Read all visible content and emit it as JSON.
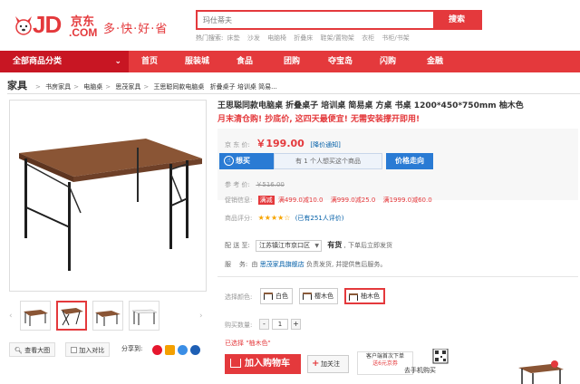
{
  "header": {
    "logo_jd": "JD",
    "logo_cn": "京东",
    "logo_com": ".COM",
    "slogan": "多·快·好·省",
    "search_placeholder": "玛仕蒂夫",
    "search_button": "搜索",
    "hot_label": "热门搜索:",
    "hot_words": [
      "床垫",
      "沙发",
      "电脑椅",
      "折叠床",
      "鞋架/置物架",
      "衣柜",
      "书柜/书架"
    ]
  },
  "nav": {
    "all_categories": "全部商品分类",
    "items": [
      "首页",
      "服装城",
      "食品",
      "团购",
      "夺宝岛",
      "闪购",
      "金融"
    ]
  },
  "breadcrumb": {
    "home": "家具",
    "items": [
      "书房家具",
      "电脑桌",
      "思茂家具",
      "王思聪同款电脑桌",
      "折叠桌子 培训桌 简易..."
    ]
  },
  "product": {
    "title": "王思聪同款电脑桌 折叠桌子 培训桌 简易桌 方桌 书桌 1200*450*750mm 柚木色",
    "promo": "月末清仓购! 抄底价, 这四天最便宜! 无需安装撑开即用!",
    "jd_price_label": "京 东 价:",
    "jd_price": "￥199.00",
    "price_notice": "[降价通知]",
    "want_button": "想买",
    "want_count": "有 1 个人想买这个商品",
    "trend_button": "价格走向",
    "ref_price_label": "参 考 价:",
    "ref_price": "￥516.00",
    "promo_label": "促销信息:",
    "promo_tag": "满减",
    "promo_details": [
      "满499.0减10.0",
      "满999.0减25.0",
      "满1999.0减60.0"
    ],
    "rating_label": "商品评分:",
    "rating_stars": "★★★★☆",
    "rating_reviews": "(已有251人评价)",
    "ship_label": "配 送 至:",
    "ship_region": "江苏镇江市京口区",
    "stock": "有货",
    "stock_note": ", 下单后立即发货",
    "service_label": "服    务:",
    "service_by": "由",
    "service_shop": "思茂家具旗舰店",
    "service_note": "负责发货, 并提供售后服务。",
    "color_label": "选择颜色:",
    "colors": [
      "白色",
      "樱木色",
      "柚木色"
    ],
    "selected_color_index": 2,
    "qty_label": "购买数量:",
    "qty_value": "1",
    "selected_text": "已选择 \"柚木色\"",
    "cart_button": "加入购物车",
    "follow_button": "加关注",
    "phone_line1": "客户端首次下单",
    "phone_line2": "送6元京券",
    "qr_label": "去手机购买"
  },
  "image_tools": {
    "zoom": "查看大图",
    "compare": "加入对比",
    "share": "分享到:"
  },
  "colors": {
    "brand_red": "#e4393c",
    "nav_dark": "#c81623",
    "blue": "#2a7bd4",
    "link": "#005ea7"
  }
}
